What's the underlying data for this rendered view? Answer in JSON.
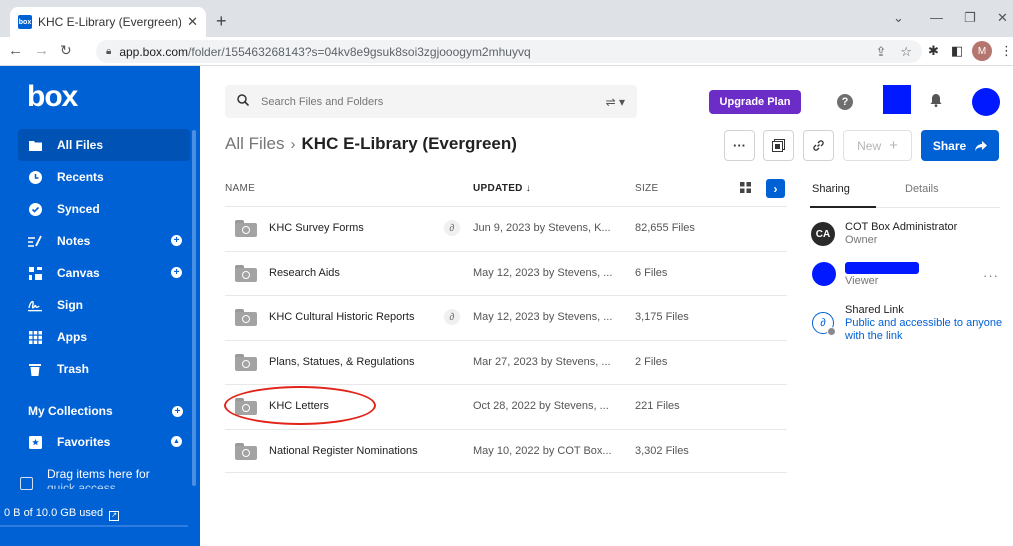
{
  "browser": {
    "tab_title": "KHC E-Library (Evergreen) | Powe",
    "tab_favicon_text": "box",
    "url_host": "app.box.com",
    "url_path": "/folder/155463268143?s=04kv8e9gsuk8soi3zgjooogym2mhuyvq",
    "profile_initial": "M"
  },
  "sidebar": {
    "logo": "box",
    "items": [
      {
        "label": "All Files",
        "icon": "folder-icon"
      },
      {
        "label": "Recents",
        "icon": "clock-icon"
      },
      {
        "label": "Synced",
        "icon": "check-circle-icon"
      },
      {
        "label": "Notes",
        "icon": "notes-icon"
      },
      {
        "label": "Canvas",
        "icon": "canvas-icon"
      },
      {
        "label": "Sign",
        "icon": "sign-icon"
      },
      {
        "label": "Apps",
        "icon": "apps-grid-icon"
      },
      {
        "label": "Trash",
        "icon": "trash-icon"
      }
    ],
    "collections_label": "My Collections",
    "favorites_label": "Favorites",
    "quick_access_line1": "Drag items here for",
    "quick_access_line2": "quick access",
    "usage": "0 B of 10.0 GB used"
  },
  "header": {
    "search_placeholder": "Search Files and Folders",
    "upgrade_label": "Upgrade Plan",
    "help_label": "?"
  },
  "breadcrumb": {
    "root": "All Files",
    "current": "KHC E-Library (Evergreen)"
  },
  "actions": {
    "more_label": "···",
    "new_label": "New",
    "share_label": "Share"
  },
  "table": {
    "col_name": "NAME",
    "col_updated": "UPDATED",
    "col_size": "SIZE",
    "rows": [
      {
        "name": "KHC Survey Forms",
        "updated": "Jun 9, 2023 by Stevens, K...",
        "size": "82,655 Files",
        "shared_link": true
      },
      {
        "name": "Research Aids",
        "updated": "May 12, 2023 by Stevens, ...",
        "size": "6 Files",
        "shared_link": false
      },
      {
        "name": "KHC Cultural Historic Reports",
        "updated": "May 12, 2023 by Stevens, ...",
        "size": "3,175 Files",
        "shared_link": true
      },
      {
        "name": "Plans, Statues, & Regulations",
        "updated": "Mar 27, 2023 by Stevens, ...",
        "size": "2 Files",
        "shared_link": false
      },
      {
        "name": "KHC Letters",
        "updated": "Oct 28, 2022 by Stevens, ...",
        "size": "221 Files",
        "shared_link": false
      },
      {
        "name": "National Register Nominations",
        "updated": "May 10, 2022 by COT Box...",
        "size": "3,302 Files",
        "shared_link": false
      }
    ]
  },
  "panel": {
    "tab_sharing": "Sharing",
    "tab_details": "Details",
    "owner_initials": "CA",
    "owner_name": "COT Box Administrator",
    "owner_role": "Owner",
    "viewer_role": "Viewer",
    "shared_link_title": "Shared Link",
    "shared_link_desc": "Public and accessible to anyone with the link"
  },
  "colors": {
    "brand_blue": "#0061d5",
    "upgrade_purple": "#6c2cc7",
    "annotation_red": "#e2231a",
    "redaction_blue": "#0019ff"
  }
}
